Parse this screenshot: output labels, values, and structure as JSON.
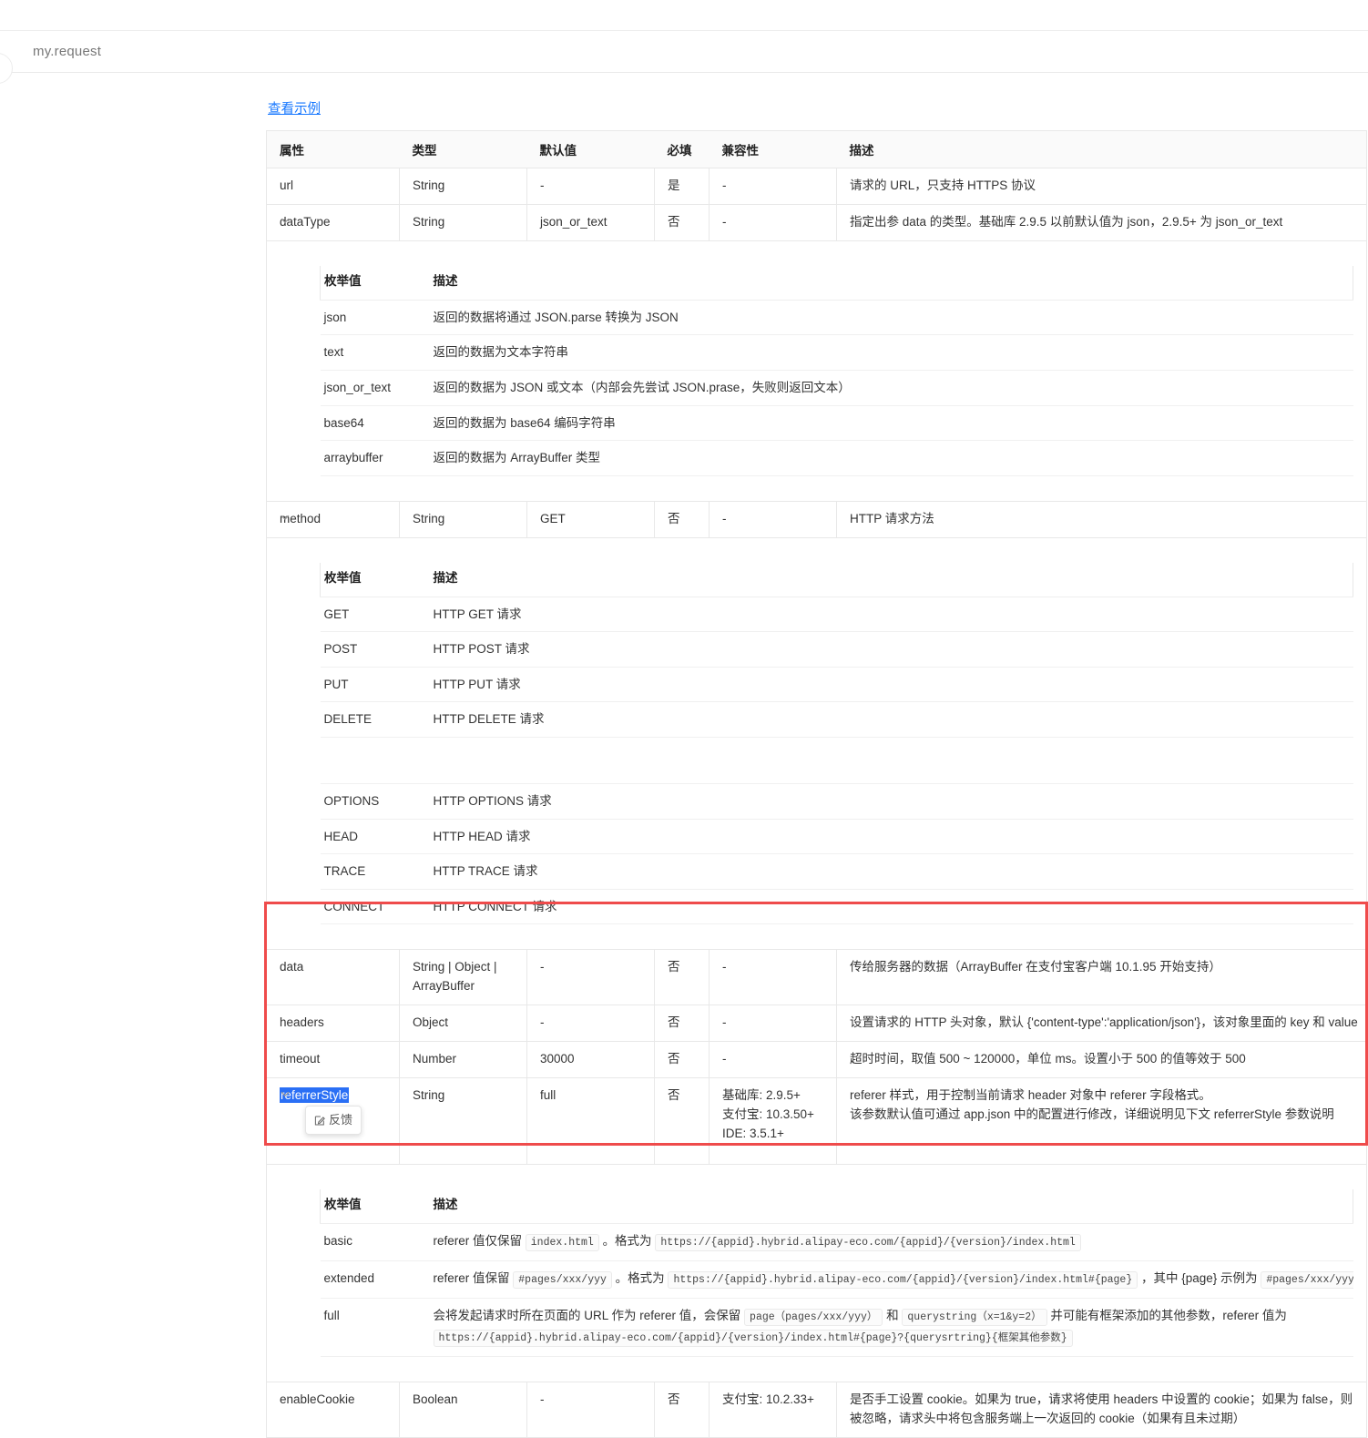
{
  "breadcrumb": {
    "title": "my.request"
  },
  "links": {
    "view_example": "查看示例"
  },
  "table": {
    "headers": {
      "attr": "属性",
      "type": "类型",
      "default": "默认值",
      "required": "必填",
      "compat": "兼容性",
      "desc": "描述"
    },
    "rows": [
      {
        "attr": "url",
        "type": "String",
        "default": "-",
        "required": "是",
        "compat": "-",
        "desc": "请求的 URL，只支持 HTTPS 协议"
      },
      {
        "attr": "dataType",
        "type": "String",
        "default": "json_or_text",
        "required": "否",
        "compat": "-",
        "desc": "指定出参 data 的类型。基础库 2.9.5 以前默认值为 json，2.9.5+ 为 json_or_text"
      },
      {
        "attr": "method",
        "type": "String",
        "default": "GET",
        "required": "否",
        "compat": "-",
        "desc": "HTTP 请求方法"
      },
      {
        "attr": "data",
        "type": "String | Object | ArrayBuffer",
        "default": "-",
        "required": "否",
        "compat": "-",
        "desc": "传给服务器的数据（ArrayBuffer 在支付宝客户端 10.1.95 开始支持）"
      },
      {
        "attr": "headers",
        "type": "Object",
        "default": "-",
        "required": "否",
        "compat": "-",
        "desc": "设置请求的 HTTP 头对象，默认 {'content-type':'application/json'}，该对象里面的 key 和 value"
      },
      {
        "attr": "timeout",
        "type": "Number",
        "default": "30000",
        "required": "否",
        "compat": "-",
        "desc": "超时时间，取值 500 ~ 120000，单位 ms。设置小于 500 的值等效于 500"
      },
      {
        "attr": "referrerStyle",
        "type": "String",
        "default": "full",
        "required": "否",
        "compat_lines": [
          "基础库: 2.9.5+",
          "支付宝: 10.3.50+",
          "IDE: 3.5.1+"
        ],
        "desc_lines": [
          "referer 样式，用于控制当前请求 header 对象中 referer 字段格式。",
          "该参数默认值可通过 app.json 中的配置进行修改，详细说明见下文 referrerStyle 参数说明"
        ],
        "selected": true,
        "feedback_label": "反馈"
      },
      {
        "attr": "enableCookie",
        "type": "Boolean",
        "default": "-",
        "required": "否",
        "compat": "支付宝: 10.2.33+",
        "desc": "是否手工设置 cookie。如果为 true，请求将使用 headers 中设置的 cookie；如果为 false，则被忽略，请求头中将包含服务端上一次返回的 cookie（如果有且未过期）"
      }
    ]
  },
  "enum_tables": {
    "headers": {
      "key": "枚举值",
      "desc": "描述"
    },
    "dataType": [
      {
        "key": "json",
        "desc": "返回的数据将通过 JSON.parse 转换为 JSON"
      },
      {
        "key": "text",
        "desc": "返回的数据为文本字符串"
      },
      {
        "key": "json_or_text",
        "desc": "返回的数据为 JSON 或文本（内部会先尝试 JSON.prase，失败则返回文本）"
      },
      {
        "key": "base64",
        "desc": "返回的数据为 base64 编码字符串"
      },
      {
        "key": "arraybuffer",
        "desc": "返回的数据为 ArrayBuffer 类型"
      }
    ],
    "method": [
      {
        "key": "GET",
        "desc": "HTTP GET 请求"
      },
      {
        "key": "POST",
        "desc": "HTTP POST 请求"
      },
      {
        "key": "PUT",
        "desc": "HTTP PUT 请求"
      },
      {
        "key": "DELETE",
        "desc": "HTTP DELETE 请求"
      },
      {
        "key": "",
        "desc": ""
      },
      {
        "key": "OPTIONS",
        "desc": "HTTP OPTIONS 请求"
      },
      {
        "key": "HEAD",
        "desc": "HTTP HEAD 请求"
      },
      {
        "key": "TRACE",
        "desc": "HTTP TRACE 请求"
      },
      {
        "key": "CONNECT",
        "desc": "HTTP CONNECT 请求"
      }
    ],
    "referrerStyle": {
      "basic": {
        "key": "basic",
        "t1": "referer 值仅保留",
        "code1": "index.html",
        "t2": "。格式为",
        "code2": "https://{appid}.hybrid.alipay-eco.com/{appid}/{version}/index.html"
      },
      "extended": {
        "key": "extended",
        "t1": "referer 值保留",
        "code1": "#pages/xxx/yyy",
        "t2": "。格式为",
        "code2": "https://{appid}.hybrid.alipay-eco.com/{appid}/{version}/index.html#{page}",
        "t3": "，其中 {page} 示例为",
        "code3": "#pages/xxx/yyy"
      },
      "full": {
        "key": "full",
        "t1": "会将发起请求时所在页面的 URL 作为 referer 值，会保留",
        "code1": "page（pages/xxx/yyy）",
        "t2": "和",
        "code2": "querystring（x=1&y=2）",
        "t3": "并可能有框架添加的其他参数，referer 值为",
        "code3": "https://{appid}.hybrid.alipay-eco.com/{appid}/{version}/index.html#{page}?{querysrtring}{框架其他参数}"
      }
    }
  },
  "colors": {
    "link": "#1677ff",
    "highlight_selection": "#2a6ff5",
    "red_box": "#ef4b4b"
  }
}
